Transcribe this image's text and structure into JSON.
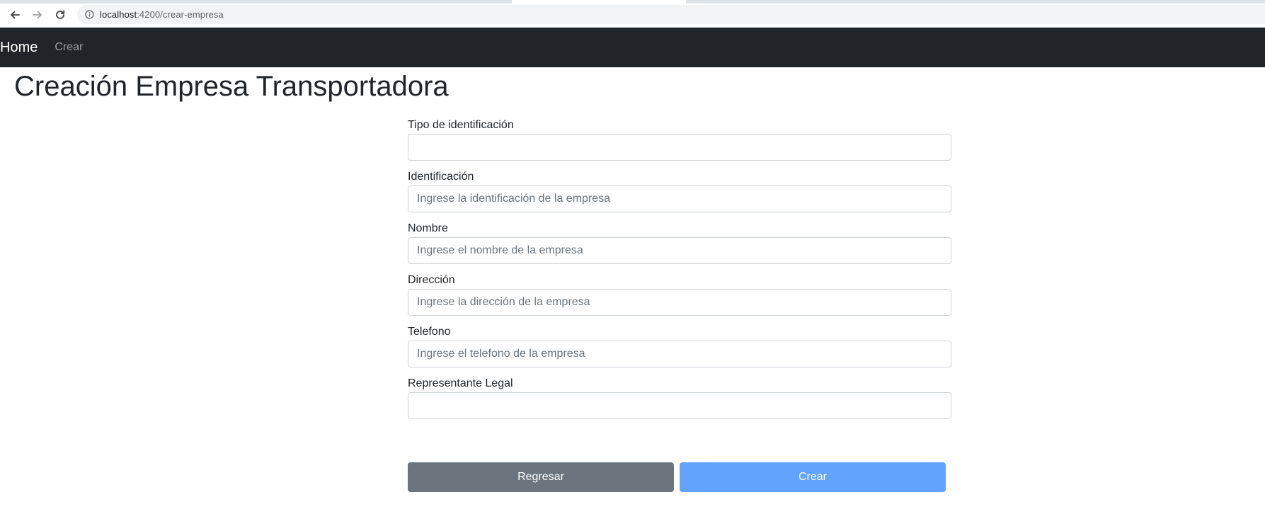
{
  "browser": {
    "url_host": "localhost",
    "url_rest": ":4200/crear-empresa",
    "icons": [
      "back-icon",
      "forward-icon",
      "reload-icon",
      "info-icon"
    ]
  },
  "navbar": {
    "brand": "Home",
    "links": [
      "Crear"
    ]
  },
  "page": {
    "title": "Creación Empresa Transportadora"
  },
  "form": {
    "fields": [
      {
        "label": "Tipo de identificación",
        "placeholder": "",
        "value": ""
      },
      {
        "label": "Identificación",
        "placeholder": "Ingrese la identificación de la empresa",
        "value": ""
      },
      {
        "label": "Nombre",
        "placeholder": "Ingrese el nombre de la empresa",
        "value": ""
      },
      {
        "label": "Dirección",
        "placeholder": "Ingrese la dirección de la empresa",
        "value": ""
      },
      {
        "label": "Telefono",
        "placeholder": "Ingrese el telefono de la empresa",
        "value": ""
      },
      {
        "label": "Representante Legal",
        "placeholder": "",
        "value": ""
      }
    ],
    "back_label": "Regresar",
    "submit_label": "Crear"
  },
  "colors": {
    "navbar_bg": "#212529",
    "back_button": "#6c757d",
    "submit_button": "#62a3fd"
  }
}
